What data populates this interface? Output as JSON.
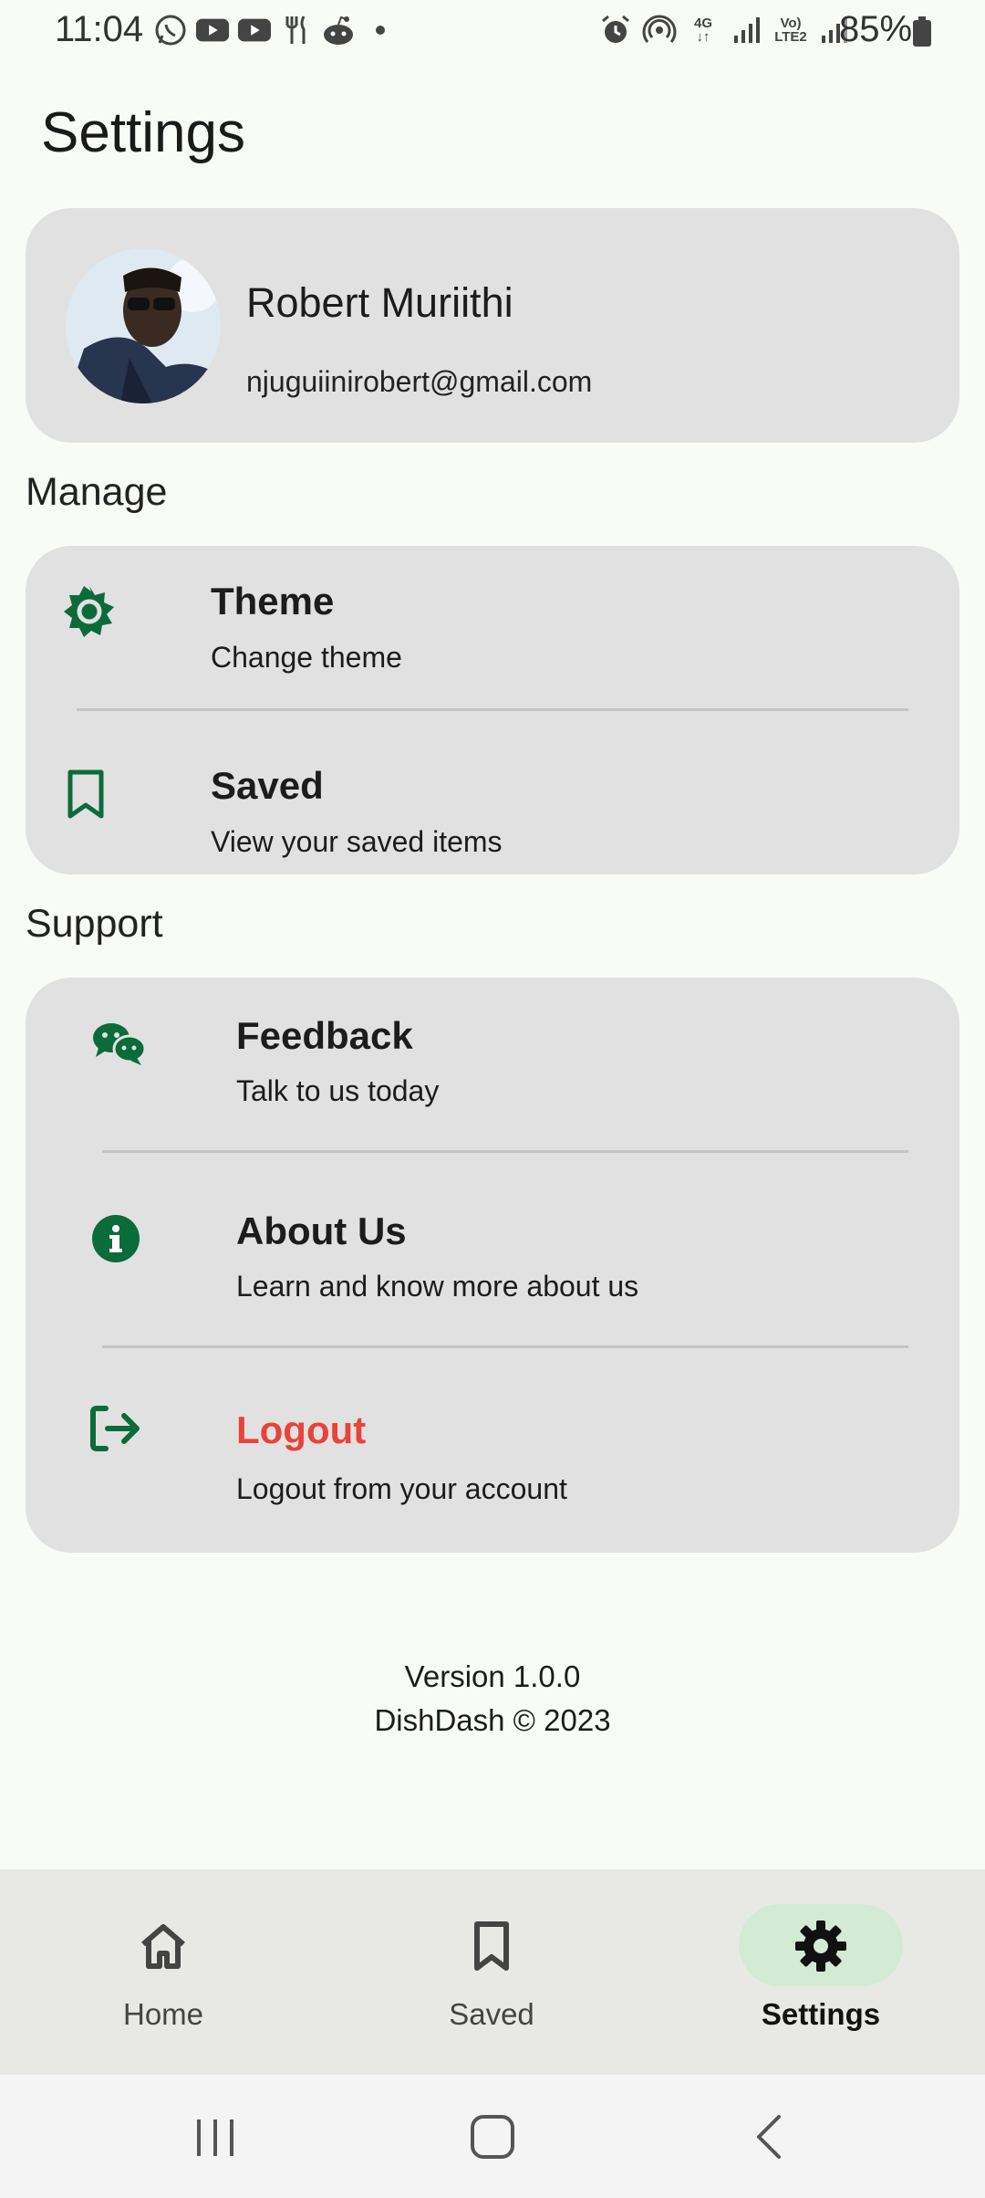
{
  "status_bar": {
    "time": "11:04",
    "battery": "85%",
    "network": "4G",
    "lte": "Vo) LTE2"
  },
  "page": {
    "title": "Settings"
  },
  "profile": {
    "name": "Robert Muriithi",
    "email": "njuguiinirobert@gmail.com"
  },
  "manage": {
    "label": "Manage",
    "items": [
      {
        "title": "Theme",
        "subtitle": "Change theme",
        "icon": "gear-sun-icon"
      },
      {
        "title": "Saved",
        "subtitle": "View your saved items",
        "icon": "bookmark-icon"
      }
    ]
  },
  "support": {
    "label": "Support",
    "items": [
      {
        "title": "Feedback",
        "subtitle": "Talk to us today",
        "icon": "chat-icon"
      },
      {
        "title": "About Us",
        "subtitle": "Learn and know more about us",
        "icon": "info-icon"
      },
      {
        "title": "Logout",
        "subtitle": "Logout from your account",
        "icon": "logout-icon"
      }
    ]
  },
  "footer": {
    "version": "Version 1.0.0",
    "copyright": "DishDash © 2023"
  },
  "bottom_nav": {
    "items": [
      {
        "label": "Home",
        "icon": "home-icon",
        "active": false
      },
      {
        "label": "Saved",
        "icon": "bookmark-icon",
        "active": false
      },
      {
        "label": "Settings",
        "icon": "gear-icon",
        "active": true
      }
    ]
  },
  "colors": {
    "accent": "#0b6b3a",
    "logout": "#e8433a",
    "card": "#e1e1e1",
    "background": "#f9fbf6",
    "active_pill": "#d3ead5"
  }
}
